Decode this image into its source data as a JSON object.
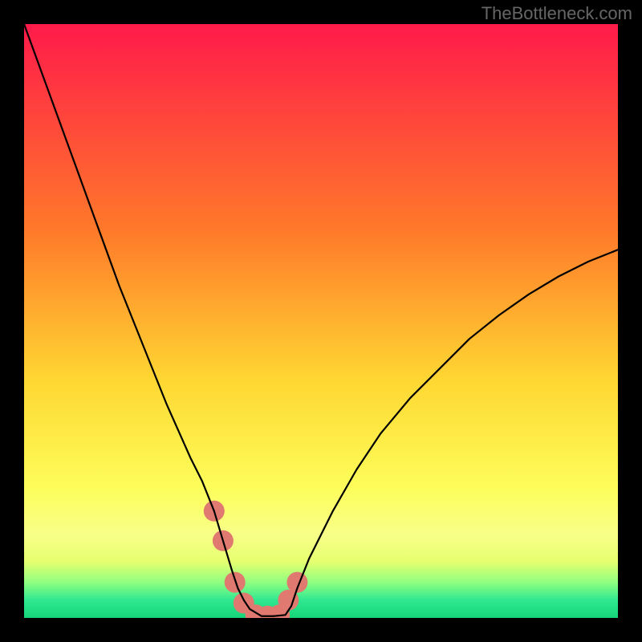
{
  "watermark": "TheBottleneck.com",
  "chart_data": {
    "type": "line",
    "title": "",
    "xlabel": "",
    "ylabel": "",
    "xlim": [
      0,
      100
    ],
    "ylim": [
      0,
      100
    ],
    "x": [
      0,
      4,
      8,
      12,
      16,
      20,
      24,
      28,
      30,
      32,
      33.5,
      35,
      36,
      37,
      38,
      40,
      42,
      44,
      45,
      46,
      48,
      52,
      56,
      60,
      65,
      70,
      75,
      80,
      85,
      90,
      95,
      100
    ],
    "y": [
      100,
      89,
      78,
      67,
      56,
      46,
      36,
      27,
      23,
      18,
      13,
      8,
      5,
      3,
      1.5,
      0.3,
      0.3,
      0.5,
      2,
      5,
      10,
      18,
      25,
      31,
      37,
      42,
      47,
      51,
      54.5,
      57.5,
      60,
      62
    ],
    "highlights_x": [
      32,
      33.5,
      35.5,
      37,
      39,
      41,
      43,
      44.5,
      46
    ],
    "highlights_y": [
      18,
      13,
      6,
      2.5,
      0.5,
      0.3,
      0.5,
      3,
      6
    ],
    "gradient_stops": [
      {
        "offset": 0,
        "color": "#ff1a4a"
      },
      {
        "offset": 0.35,
        "color": "#ff7a2a"
      },
      {
        "offset": 0.6,
        "color": "#ffd732"
      },
      {
        "offset": 0.78,
        "color": "#fdfd5a"
      },
      {
        "offset": 0.86,
        "color": "#f8ff88"
      },
      {
        "offset": 0.905,
        "color": "#e6ff70"
      },
      {
        "offset": 0.94,
        "color": "#90ff80"
      },
      {
        "offset": 0.97,
        "color": "#30e890"
      },
      {
        "offset": 1.0,
        "color": "#14d47a"
      }
    ],
    "highlight_color": "#e07a70",
    "curve_color": "#000000"
  }
}
